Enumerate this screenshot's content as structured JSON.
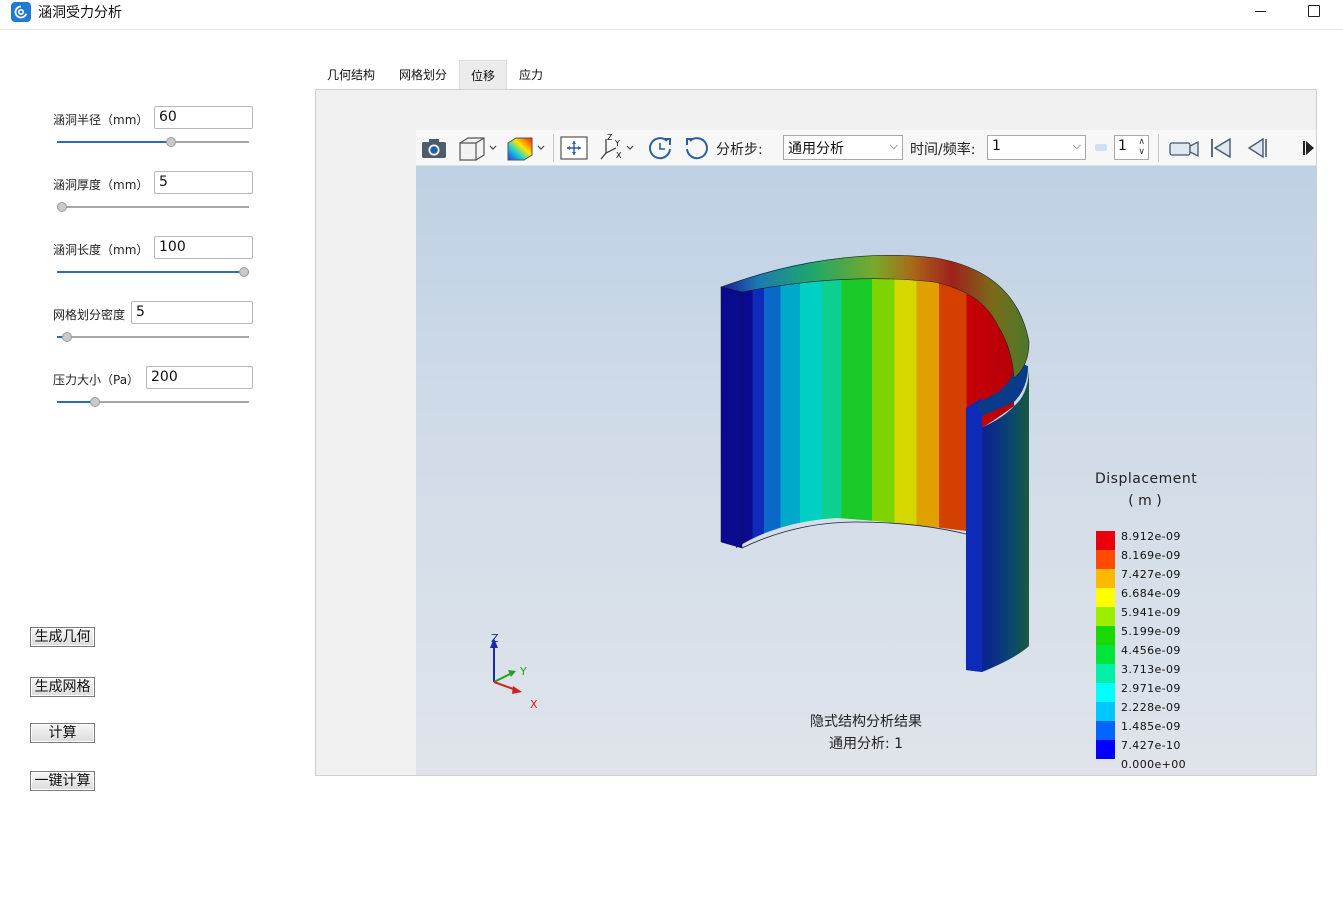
{
  "window": {
    "title": "涵洞受力分析"
  },
  "params": [
    {
      "label": "涵洞半径（mm）",
      "value": "60",
      "fraction": 0.6
    },
    {
      "label": "涵洞厚度（mm）",
      "value": "5",
      "fraction": 0.0
    },
    {
      "label": "涵洞长度（mm）",
      "value": "100",
      "fraction": 1.0
    },
    {
      "label": "网格划分密度",
      "value": "5",
      "fraction": 0.03
    },
    {
      "label": "压力大小（Pa）",
      "value": "200",
      "fraction": 0.18
    }
  ],
  "buttons": {
    "gen_geometry": "生成几何",
    "gen_mesh": "生成网格",
    "compute": "计算",
    "one_click": "一键计算"
  },
  "tabs": [
    "几何结构",
    "网格划分",
    "位移",
    "应力"
  ],
  "active_tab": "位移",
  "toolbar": {
    "step_label": "分析步:",
    "step_value": "通用分析",
    "time_label": "时间/频率:",
    "time_value": "1",
    "frame_value": "1",
    "icons": [
      "camera-icon",
      "view-cube-icon",
      "color-map-icon",
      "fit-view-icon",
      "axes-icon",
      "rotate-ccw-icon",
      "rotate-cw-icon",
      "record-icon",
      "first-frame-icon",
      "prev-frame-icon",
      "next-frame-icon"
    ]
  },
  "viewer": {
    "caption_line1": "隐式结构分析结果",
    "caption_line2": "通用分析: 1",
    "axes": {
      "z": "Z",
      "y": "Y",
      "x": "X"
    }
  },
  "legend": {
    "title": "Displacement",
    "unit": "( m )",
    "values": [
      "8.912e-09",
      "8.169e-09",
      "7.427e-09",
      "6.684e-09",
      "5.941e-09",
      "5.199e-09",
      "4.456e-09",
      "3.713e-09",
      "2.971e-09",
      "2.228e-09",
      "1.485e-09",
      "7.427e-10",
      "0.000e+00"
    ],
    "colors": [
      "#e8000b",
      "#ff4a00",
      "#ffb800",
      "#ffff00",
      "#9cee00",
      "#1bd900",
      "#00e43b",
      "#00f0a8",
      "#00ffff",
      "#00c8ff",
      "#0066ff",
      "#0000ff"
    ]
  }
}
